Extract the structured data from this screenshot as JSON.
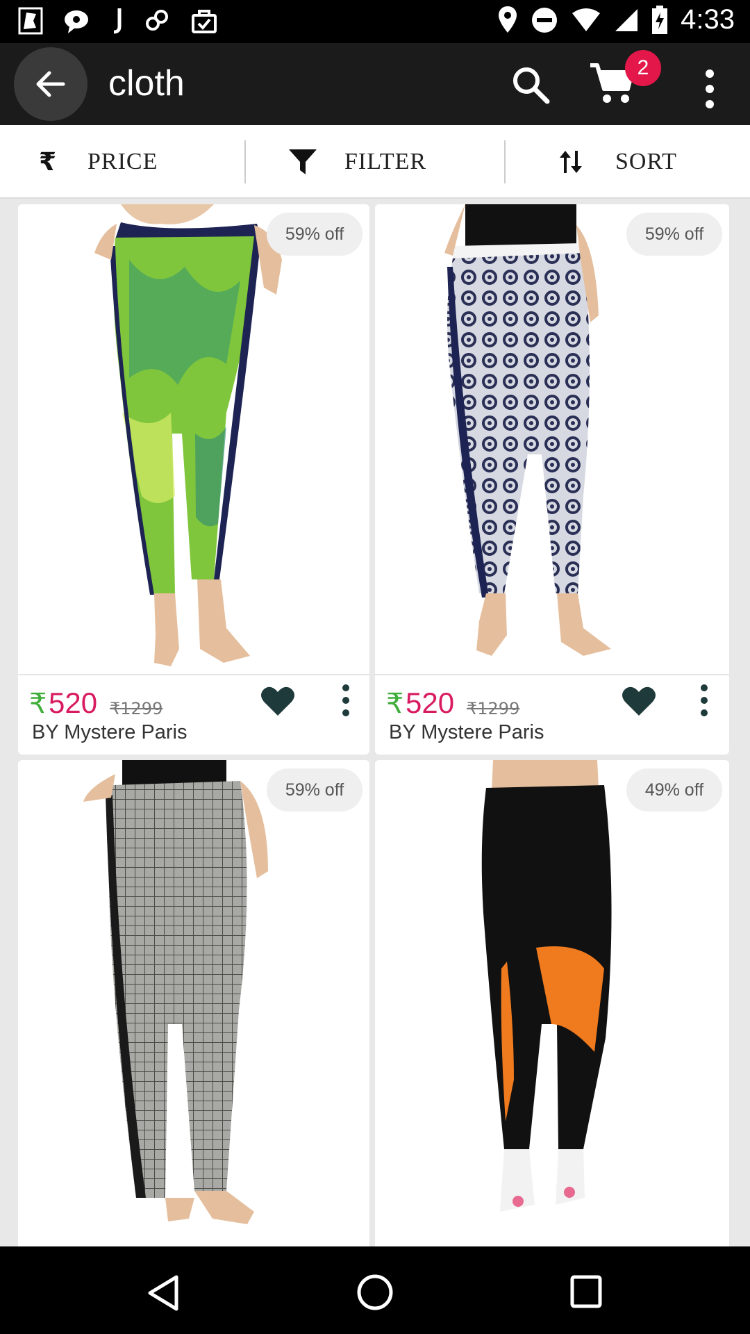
{
  "status_bar": {
    "time": "4:33"
  },
  "app_bar": {
    "title": "cloth",
    "cart_count": "2"
  },
  "actions": [
    {
      "label": "PRICE"
    },
    {
      "label": "FILTER"
    },
    {
      "label": "SORT"
    }
  ],
  "products": [
    {
      "discount": "59% off",
      "currency": "₹",
      "price": "520",
      "old_price": "₹1299",
      "brand": "BY Mystere Paris"
    },
    {
      "discount": "59% off",
      "currency": "₹",
      "price": "520",
      "old_price": "₹1299",
      "brand": "BY Mystere Paris"
    },
    {
      "discount": "59% off"
    },
    {
      "discount": "49% off"
    }
  ],
  "colors": {
    "accent": "#e3174a",
    "price": "#d81b60",
    "rupee": "#3fae3a",
    "app_bar": "#1b1b1b"
  },
  "icons": {
    "back": "arrow-left-icon",
    "search": "search-icon",
    "cart": "cart-icon",
    "more": "more-vert-icon",
    "price": "rupee-icon",
    "filter": "filter-icon",
    "sort": "sort-icon",
    "wishlist": "heart-icon"
  }
}
